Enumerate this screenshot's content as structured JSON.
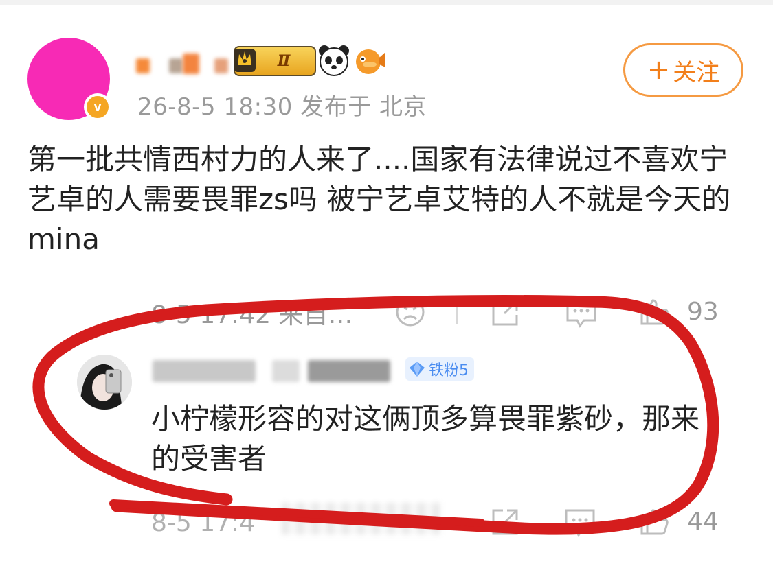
{
  "post": {
    "meta": "26-8-5 18:30  发布于 北京",
    "level_badge": "Ⅱ",
    "verified_badge": "v",
    "follow_label": "关注",
    "follow_plus": "+",
    "text": "第一批共情西村力的人来了....国家有法律说过不喜欢宁艺卓的人需要畏罪zs吗 被宁艺卓艾特的人不就是今天的mina"
  },
  "action_bar": {
    "time": "8-5 17:42 来自…",
    "like_count": "93"
  },
  "comment": {
    "badge": "铁粉5",
    "text": "小柠檬形容的对这俩顶多算畏罪紫砂，那来的受害者"
  },
  "comment_bar": {
    "time": "8-5 17:4",
    "like_count": "44"
  },
  "colors": {
    "avatar": "#f72ab5",
    "follow_accent": "#f27f1b",
    "annotation": "#d51d1d"
  },
  "icons": [
    "verified-icon",
    "crown-icon",
    "panda-icon",
    "pufferfish-icon",
    "sad-face-icon",
    "share-icon",
    "comment-icon",
    "like-icon",
    "diamond-icon"
  ]
}
